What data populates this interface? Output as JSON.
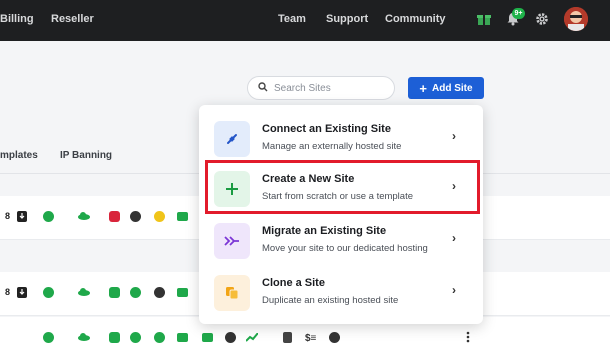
{
  "topbar": {
    "nav_left": [
      "Billing",
      "Reseller"
    ],
    "nav_right": [
      "Team",
      "Support",
      "Community"
    ],
    "notification_count": "9+",
    "icons": [
      "gift-icon",
      "bell-icon",
      "gear-icon",
      "avatar"
    ]
  },
  "toolbar": {
    "search_placeholder": "Search Sites",
    "add_site_label": "Add Site"
  },
  "tabs": [
    "mplates",
    "IP Banning"
  ],
  "rows": [
    {
      "count": "8"
    },
    {
      "count": "8"
    },
    {
      "count": ""
    }
  ],
  "dropdown": {
    "items": [
      {
        "title": "Connect an Existing Site",
        "subtitle": "Manage an externally hosted site",
        "icon": "plug-icon",
        "icon_bg": "#e3ecfb",
        "icon_color": "#2456c8"
      },
      {
        "title": "Create a New Site",
        "subtitle": "Start from scratch or use a template",
        "icon": "plus-icon",
        "icon_bg": "#e3f5e8",
        "icon_color": "#1a9b42"
      },
      {
        "title": "Migrate an Existing Site",
        "subtitle": "Move your site to our dedicated hosting",
        "icon": "migrate-icon",
        "icon_bg": "#efe6fb",
        "icon_color": "#7b36d6"
      },
      {
        "title": "Clone a Site",
        "subtitle": "Duplicate an existing hosted site",
        "icon": "clone-icon",
        "icon_bg": "#fdf0dc",
        "icon_color": "#f2a516"
      }
    ]
  },
  "colors": {
    "topbar_bg": "#1e1f21",
    "accent": "#1d5fd6",
    "highlight": "#e21b2b",
    "status_green": "#1fa84a"
  }
}
